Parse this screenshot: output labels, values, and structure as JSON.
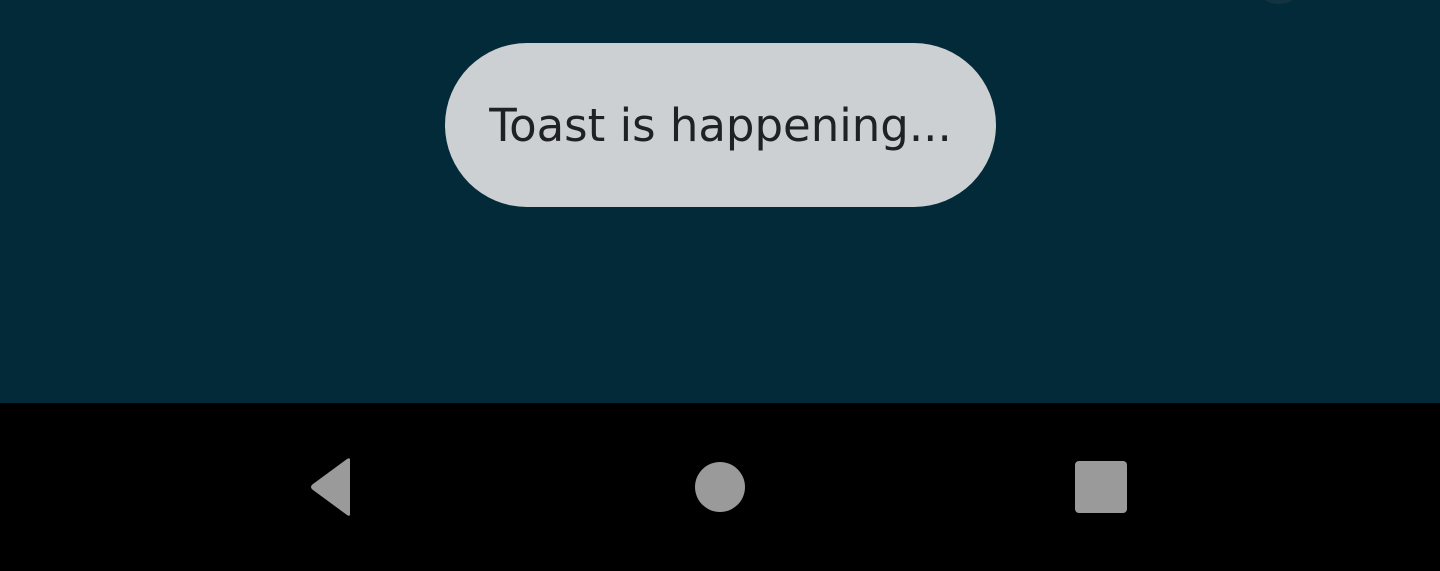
{
  "toast": {
    "message": "Toast is happening..."
  },
  "navigation_bar": {
    "buttons": [
      {
        "name": "back",
        "icon": "back-triangle-icon"
      },
      {
        "name": "home",
        "icon": "home-circle-icon"
      },
      {
        "name": "recents",
        "icon": "recents-square-icon"
      }
    ],
    "icon_color": "#9a9a9a",
    "background": "#000000"
  },
  "theme": {
    "app_background": "#022a38",
    "toast_background": "#ccd0d2",
    "toast_text_color": "#202124"
  }
}
